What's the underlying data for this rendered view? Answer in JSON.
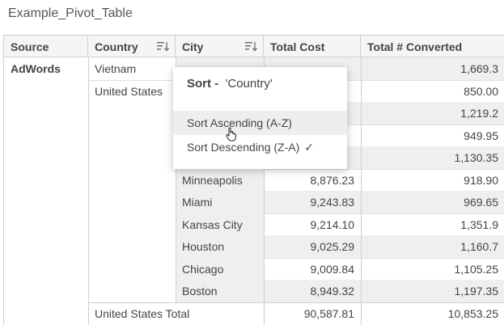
{
  "title": "Example_Pivot_Table",
  "headers": {
    "source": "Source",
    "country": "Country",
    "city": "City",
    "cost": "Total Cost",
    "converted": "Total # Converted"
  },
  "rows": [
    {
      "source": "AdWords",
      "country": "Vietnam",
      "city": "",
      "cost": "",
      "converted": "1,669.3"
    },
    {
      "source": "",
      "country": "United States",
      "city": "",
      "cost": "",
      "converted": "850.00"
    },
    {
      "source": "",
      "country": "",
      "city": "",
      "cost": "",
      "converted": "1,219.2"
    },
    {
      "source": "",
      "country": "",
      "city": "",
      "cost": "",
      "converted": "949.95"
    },
    {
      "source": "",
      "country": "",
      "city": "",
      "cost": "",
      "converted": "1,130.35"
    },
    {
      "source": "",
      "country": "",
      "city": "Minneapolis",
      "cost": "8,876.23",
      "converted": "918.90"
    },
    {
      "source": "",
      "country": "",
      "city": "Miami",
      "cost": "9,243.83",
      "converted": "969.65"
    },
    {
      "source": "",
      "country": "",
      "city": "Kansas City",
      "cost": "9,214.10",
      "converted": "1,351.9"
    },
    {
      "source": "",
      "country": "",
      "city": "Houston",
      "cost": "9,025.29",
      "converted": "1,160.7"
    },
    {
      "source": "",
      "country": "",
      "city": "Chicago",
      "cost": "9,009.84",
      "converted": "1,105.25"
    },
    {
      "source": "",
      "country": "",
      "city": "Boston",
      "cost": "8,949.32",
      "converted": "1,197.35"
    }
  ],
  "total_row": {
    "label": "United States Total",
    "cost": "90,587.81",
    "converted": "10,853.25"
  },
  "sort_popup": {
    "title_prefix": "Sort -",
    "title_field": "'Country'",
    "ascending": "Sort Ascending (A-Z)",
    "descending": "Sort Descending (Z-A)",
    "checkmark": "✓"
  }
}
